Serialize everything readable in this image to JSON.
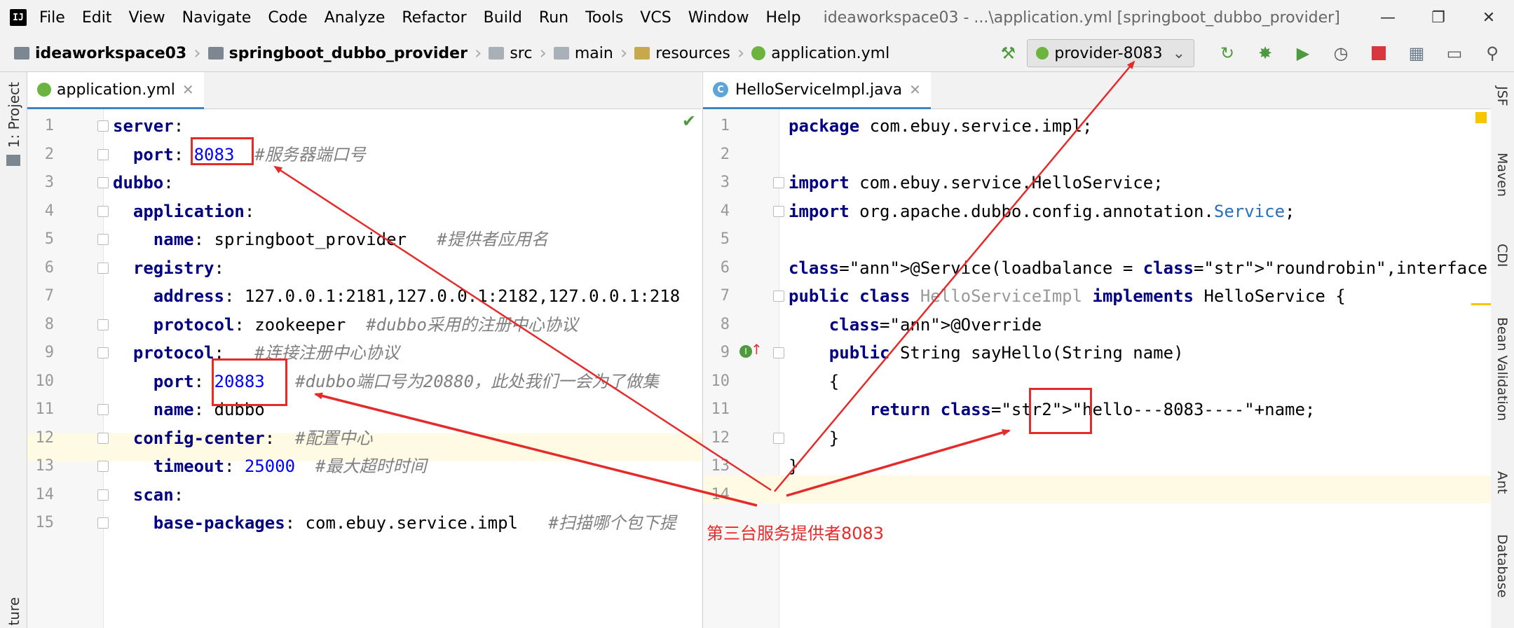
{
  "menu": {
    "items": [
      "File",
      "Edit",
      "View",
      "Navigate",
      "Code",
      "Analyze",
      "Refactor",
      "Build",
      "Run",
      "Tools",
      "VCS",
      "Window",
      "Help"
    ],
    "window_title": "ideaworkspace03 - ...\\application.yml [springboot_dubbo_provider]"
  },
  "breadcrumb": {
    "project": "ideaworkspace03",
    "module": "springboot_dubbo_provider",
    "src": "src",
    "main": "main",
    "resources": "resources",
    "file": "application.yml"
  },
  "toolbar": {
    "run_config": "provider-8083"
  },
  "left_strip": {
    "project_tab": "1: Project",
    "structure_tab": "ture"
  },
  "right_strip": [
    "JSF",
    "Maven",
    "CDI",
    "Bean Validation",
    "Ant",
    "Database"
  ],
  "left_editor": {
    "tab": "application.yml",
    "lines": [
      {
        "n": "1",
        "text": "server:"
      },
      {
        "n": "2",
        "text": "  port: 8083  #服务器端口号"
      },
      {
        "n": "3",
        "text": "dubbo:"
      },
      {
        "n": "4",
        "text": "  application:"
      },
      {
        "n": "5",
        "text": "    name: springboot_provider   #提供者应用名"
      },
      {
        "n": "6",
        "text": "  registry:"
      },
      {
        "n": "7",
        "text": "    address: 127.0.0.1:2181,127.0.0.1:2182,127.0.0.1:218"
      },
      {
        "n": "8",
        "text": "    protocol: zookeeper  #dubbo采用的注册中心协议"
      },
      {
        "n": "9",
        "text": "  protocol:   #连接注册中心协议"
      },
      {
        "n": "10",
        "text": "    port: 20883   #dubbo端口号为20880，此处我们一会为了做集"
      },
      {
        "n": "11",
        "text": "    name: dubbo"
      },
      {
        "n": "12",
        "text": "  config-center:  #配置中心"
      },
      {
        "n": "13",
        "text": "    timeout: 25000  #最大超时时间"
      },
      {
        "n": "14",
        "text": "  scan:"
      },
      {
        "n": "15",
        "text": "    base-packages: com.ebuy.service.impl   #扫描哪个包下提"
      }
    ]
  },
  "right_editor": {
    "tab": "HelloServiceImpl.java",
    "lines": [
      {
        "n": "1",
        "text": "package com.ebuy.service.impl;"
      },
      {
        "n": "2",
        "text": ""
      },
      {
        "n": "3",
        "text": "import com.ebuy.service.HelloService;"
      },
      {
        "n": "4",
        "text": "import org.apache.dubbo.config.annotation.Service;"
      },
      {
        "n": "5",
        "text": ""
      },
      {
        "n": "6",
        "text": "@Service(loadbalance = \"roundrobin\",interfaceClass = HelloService.c"
      },
      {
        "n": "7",
        "text": "public class HelloServiceImpl implements HelloService {"
      },
      {
        "n": "8",
        "text": "    @Override"
      },
      {
        "n": "9",
        "text": "    public String sayHello(String name)"
      },
      {
        "n": "10",
        "text": "    {"
      },
      {
        "n": "11",
        "text": "        return \"hello---8083----\"+name;"
      },
      {
        "n": "12",
        "text": "    }"
      },
      {
        "n": "13",
        "text": "}"
      },
      {
        "n": "14",
        "text": ""
      }
    ]
  },
  "annotation": {
    "label": "第三台服务提供者8083",
    "color": "#e52a2a"
  }
}
